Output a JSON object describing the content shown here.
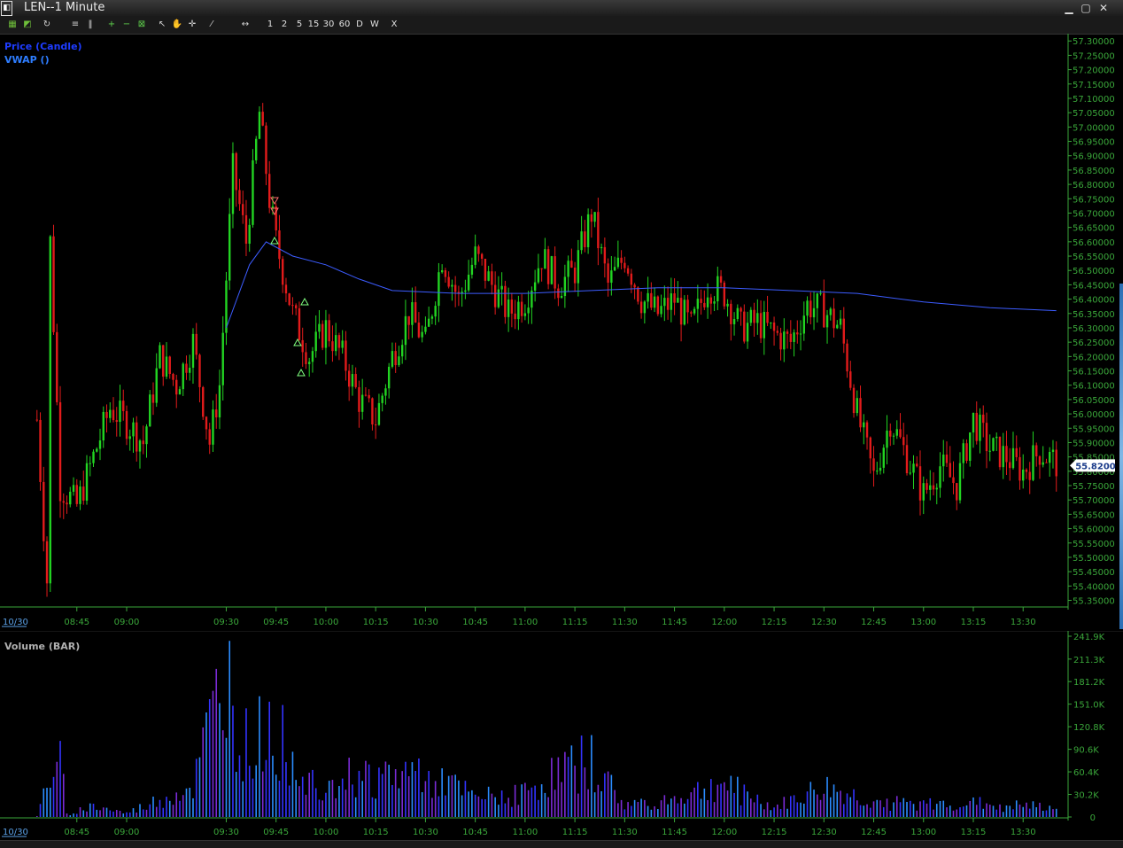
{
  "window": {
    "title": "LEN--1 Minute",
    "app_icon": "chart-app-icon",
    "controls": [
      "minimize-icon",
      "maximize-icon",
      "close-icon"
    ]
  },
  "toolbar": {
    "icon_buttons": [
      "chart-settings-icon",
      "study-icon",
      "refresh-icon",
      "lines-icon",
      "bars-icon",
      "zoom-in-icon",
      "zoom-out-icon",
      "zoom-fit-icon",
      "cursor-icon",
      "pan-hand-icon",
      "crosshair-icon",
      "draw-line-icon",
      "arrows-horizontal-icon"
    ],
    "timeframes": [
      "1",
      "2",
      "5",
      "15",
      "30",
      "60",
      "D",
      "W"
    ],
    "close_label": "X"
  },
  "price_panel": {
    "legend": [
      {
        "label": "Price (Candle)",
        "color": "#1e3cff"
      },
      {
        "label": "VWAP ()",
        "color": "#2e7dff"
      }
    ],
    "last_price": "55.8200",
    "date_label": "10/30"
  },
  "volume_panel": {
    "legend": "Volume (BAR)",
    "date_label": "10/30",
    "axis_labels": [
      "241.9K",
      "211.3K",
      "181.2K",
      "151.0K",
      "120.8K",
      "90.6K",
      "60.4K",
      "30.2K",
      "0"
    ]
  },
  "colors": {
    "up": "#22d422",
    "down": "#e21b1b",
    "vwap": "#3c5cff",
    "axis": "#3aa63a",
    "volume_a": "#2b8cff",
    "volume_b": "#7a2bd6",
    "volume_c": "#3333ff"
  },
  "chart_data": [
    {
      "type": "candlestick",
      "title": "",
      "series": [
        {
          "name": "Price (Candle)"
        },
        {
          "name": "VWAP ()"
        }
      ],
      "x_ticks": [
        "08:45",
        "09:00",
        "09:30",
        "09:45",
        "10:00",
        "10:15",
        "10:30",
        "10:45",
        "11:00",
        "11:15",
        "11:30",
        "11:45",
        "12:00",
        "12:15",
        "12:30",
        "12:45",
        "13:00",
        "13:15",
        "13:30"
      ],
      "y_ticks": [
        "57.30000",
        "57.25000",
        "57.20000",
        "57.15000",
        "57.10000",
        "57.05000",
        "57.00000",
        "56.95000",
        "56.90000",
        "56.85000",
        "56.80000",
        "56.75000",
        "56.70000",
        "56.65000",
        "56.60000",
        "56.55000",
        "56.50000",
        "56.45000",
        "56.40000",
        "56.35000",
        "56.30000",
        "56.25000",
        "56.20000",
        "56.15000",
        "56.10000",
        "56.05000",
        "56.00000",
        "55.95000",
        "55.90000",
        "55.85000",
        "55.80000",
        "55.75000",
        "55.70000",
        "55.65000",
        "55.60000",
        "55.55000",
        "55.50000",
        "55.45000",
        "55.40000",
        "55.35000"
      ],
      "ylim": [
        55.33,
        57.31
      ],
      "anchors": [
        {
          "t": "08:33",
          "price": 55.98
        },
        {
          "t": "08:36",
          "price": 55.42
        },
        {
          "t": "08:37",
          "price": 56.6
        },
        {
          "t": "08:40",
          "price": 55.75
        },
        {
          "t": "08:45",
          "price": 55.68
        },
        {
          "t": "08:50",
          "price": 55.85
        },
        {
          "t": "08:55",
          "price": 56.02
        },
        {
          "t": "09:00",
          "price": 55.97
        },
        {
          "t": "09:05",
          "price": 55.9
        },
        {
          "t": "09:10",
          "price": 56.2
        },
        {
          "t": "09:15",
          "price": 56.1
        },
        {
          "t": "09:20",
          "price": 56.25
        },
        {
          "t": "09:25",
          "price": 55.9
        },
        {
          "t": "09:28",
          "price": 56.1
        },
        {
          "t": "09:32",
          "price": 56.85
        },
        {
          "t": "09:36",
          "price": 56.6
        },
        {
          "t": "09:40",
          "price": 57.05
        },
        {
          "t": "09:43",
          "price": 56.75
        },
        {
          "t": "09:45",
          "price": 56.6
        },
        {
          "t": "09:50",
          "price": 56.35
        },
        {
          "t": "09:55",
          "price": 56.2
        },
        {
          "t": "10:00",
          "price": 56.3
        },
        {
          "t": "10:05",
          "price": 56.2
        },
        {
          "t": "10:10",
          "price": 56.05
        },
        {
          "t": "10:15",
          "price": 55.98
        },
        {
          "t": "10:20",
          "price": 56.2
        },
        {
          "t": "10:25",
          "price": 56.35
        },
        {
          "t": "10:30",
          "price": 56.25
        },
        {
          "t": "10:35",
          "price": 56.55
        },
        {
          "t": "10:40",
          "price": 56.4
        },
        {
          "t": "10:45",
          "price": 56.55
        },
        {
          "t": "10:50",
          "price": 56.45
        },
        {
          "t": "10:55",
          "price": 56.35
        },
        {
          "t": "11:00",
          "price": 56.4
        },
        {
          "t": "11:05",
          "price": 56.55
        },
        {
          "t": "11:10",
          "price": 56.45
        },
        {
          "t": "11:15",
          "price": 56.5
        },
        {
          "t": "11:20",
          "price": 56.7
        },
        {
          "t": "11:25",
          "price": 56.45
        },
        {
          "t": "11:30",
          "price": 56.55
        },
        {
          "t": "11:35",
          "price": 56.4
        },
        {
          "t": "11:40",
          "price": 56.35
        },
        {
          "t": "11:45",
          "price": 56.4
        },
        {
          "t": "11:50",
          "price": 56.3
        },
        {
          "t": "11:55",
          "price": 56.45
        },
        {
          "t": "12:00",
          "price": 56.42
        },
        {
          "t": "12:05",
          "price": 56.3
        },
        {
          "t": "12:10",
          "price": 56.32
        },
        {
          "t": "12:15",
          "price": 56.28
        },
        {
          "t": "12:20",
          "price": 56.25
        },
        {
          "t": "12:25",
          "price": 56.38
        },
        {
          "t": "12:30",
          "price": 56.36
        },
        {
          "t": "12:35",
          "price": 56.3
        },
        {
          "t": "12:40",
          "price": 56.0
        },
        {
          "t": "12:45",
          "price": 55.78
        },
        {
          "t": "12:50",
          "price": 55.98
        },
        {
          "t": "12:55",
          "price": 55.85
        },
        {
          "t": "13:00",
          "price": 55.72
        },
        {
          "t": "13:05",
          "price": 55.82
        },
        {
          "t": "13:10",
          "price": 55.75
        },
        {
          "t": "13:15",
          "price": 55.98
        },
        {
          "t": "13:20",
          "price": 55.88
        },
        {
          "t": "13:25",
          "price": 55.85
        },
        {
          "t": "13:30",
          "price": 55.8
        },
        {
          "t": "13:35",
          "price": 55.87
        },
        {
          "t": "13:40",
          "price": 55.83
        }
      ],
      "vwap": [
        {
          "t": "09:30",
          "price": 56.3
        },
        {
          "t": "09:37",
          "price": 56.52
        },
        {
          "t": "09:42",
          "price": 56.6
        },
        {
          "t": "09:50",
          "price": 56.55
        },
        {
          "t": "10:00",
          "price": 56.52
        },
        {
          "t": "10:10",
          "price": 56.47
        },
        {
          "t": "10:20",
          "price": 56.43
        },
        {
          "t": "10:40",
          "price": 56.42
        },
        {
          "t": "11:00",
          "price": 56.42
        },
        {
          "t": "11:20",
          "price": 56.43
        },
        {
          "t": "11:40",
          "price": 56.44
        },
        {
          "t": "12:00",
          "price": 56.44
        },
        {
          "t": "12:20",
          "price": 56.43
        },
        {
          "t": "12:40",
          "price": 56.42
        },
        {
          "t": "13:00",
          "price": 56.39
        },
        {
          "t": "13:20",
          "price": 56.37
        },
        {
          "t": "13:40",
          "price": 56.36
        }
      ],
      "ylabel": "",
      "xlabel": ""
    },
    {
      "type": "bar",
      "title": "",
      "series": [
        {
          "name": "Volume (BAR)"
        }
      ],
      "ylim": [
        0,
        241900
      ],
      "anchors": [
        {
          "t": "08:33",
          "v": 1000
        },
        {
          "t": "08:38",
          "v": 88000
        },
        {
          "t": "08:40",
          "v": 88000
        },
        {
          "t": "08:42",
          "v": 5000
        },
        {
          "t": "08:50",
          "v": 18000
        },
        {
          "t": "09:00",
          "v": 6000
        },
        {
          "t": "09:20",
          "v": 50000
        },
        {
          "t": "09:30",
          "v": 241900
        },
        {
          "t": "09:34",
          "v": 125000
        },
        {
          "t": "09:38",
          "v": 110000
        },
        {
          "t": "09:42",
          "v": 151000
        },
        {
          "t": "09:48",
          "v": 115000
        },
        {
          "t": "09:55",
          "v": 60000
        },
        {
          "t": "10:05",
          "v": 68000
        },
        {
          "t": "10:15",
          "v": 65000
        },
        {
          "t": "10:30",
          "v": 75000
        },
        {
          "t": "10:45",
          "v": 30000
        },
        {
          "t": "11:00",
          "v": 40000
        },
        {
          "t": "11:15",
          "v": 88000
        },
        {
          "t": "11:20",
          "v": 90000
        },
        {
          "t": "11:30",
          "v": 20000
        },
        {
          "t": "11:45",
          "v": 30000
        },
        {
          "t": "12:00",
          "v": 55000
        },
        {
          "t": "12:15",
          "v": 15000
        },
        {
          "t": "12:30",
          "v": 48000
        },
        {
          "t": "12:45",
          "v": 25000
        },
        {
          "t": "13:00",
          "v": 20000
        },
        {
          "t": "13:15",
          "v": 22000
        },
        {
          "t": "13:40",
          "v": 15000
        }
      ]
    }
  ]
}
